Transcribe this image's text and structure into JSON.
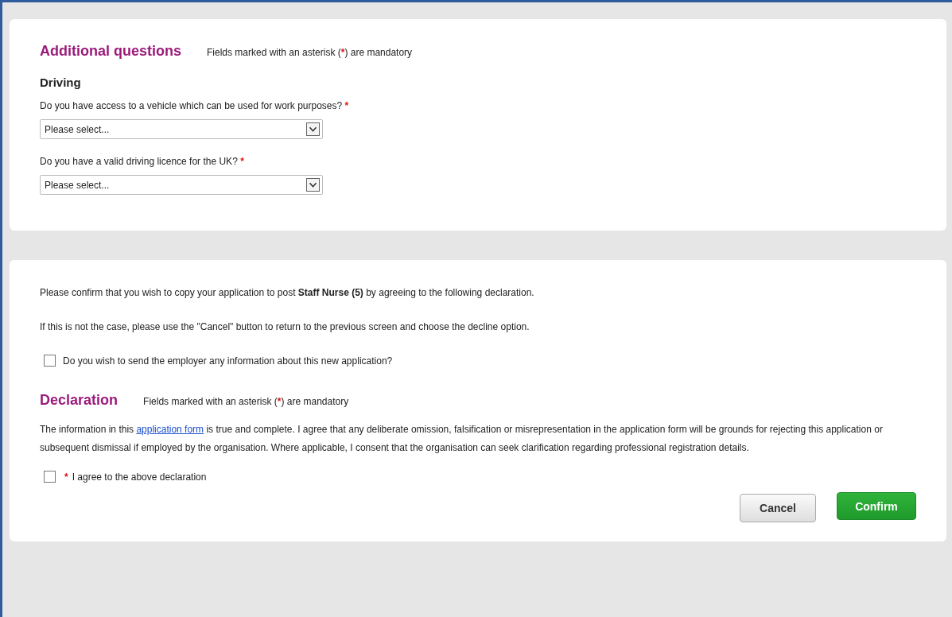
{
  "questions_card": {
    "title": "Additional questions",
    "mandatory_note": {
      "before": "Fields marked with an asterisk (",
      "star": "*",
      "after": ") are mandatory"
    },
    "section": "Driving",
    "questions": [
      {
        "label": "Do you have access to a vehicle which can be used for work purposes?",
        "required_mark": "*",
        "value": "Please select..."
      },
      {
        "label": "Do you have a valid driving licence for the UK?",
        "required_mark": "*",
        "value": "Please select..."
      }
    ]
  },
  "confirm_card": {
    "intro": "Please confirm that you wish to copy your application to post **Staff Nurse (5)** by agreeing to the following declaration.",
    "cancel_hint": "If this is not the case, please use the \"Cancel\" button to return to the previous screen and choose the decline option.",
    "send_info": {
      "label": "Do you wish to send the employer any information about this new application?",
      "checked": false
    },
    "declaration_title": "Declaration",
    "mandatory_note": {
      "before": "Fields marked with an asterisk (",
      "star": "*",
      "after": ") are mandatory"
    },
    "declaration": {
      "before": "The information in this ",
      "link": "application form",
      "after": " is true and complete. I agree that any deliberate omission, falsification or misrepresentation in the application form will be grounds for rejecting this application or subsequent dismissal if employed by the organisation. Where applicable, I consent that the organisation can seek clarification regarding professional registration details."
    },
    "agree": {
      "required_mark": "*",
      "label": "I agree to the above declaration",
      "checked": false
    },
    "buttons": [
      {
        "label": "Cancel",
        "kind": "secondary"
      },
      {
        "label": "Confirm",
        "kind": "primary"
      }
    ]
  }
}
